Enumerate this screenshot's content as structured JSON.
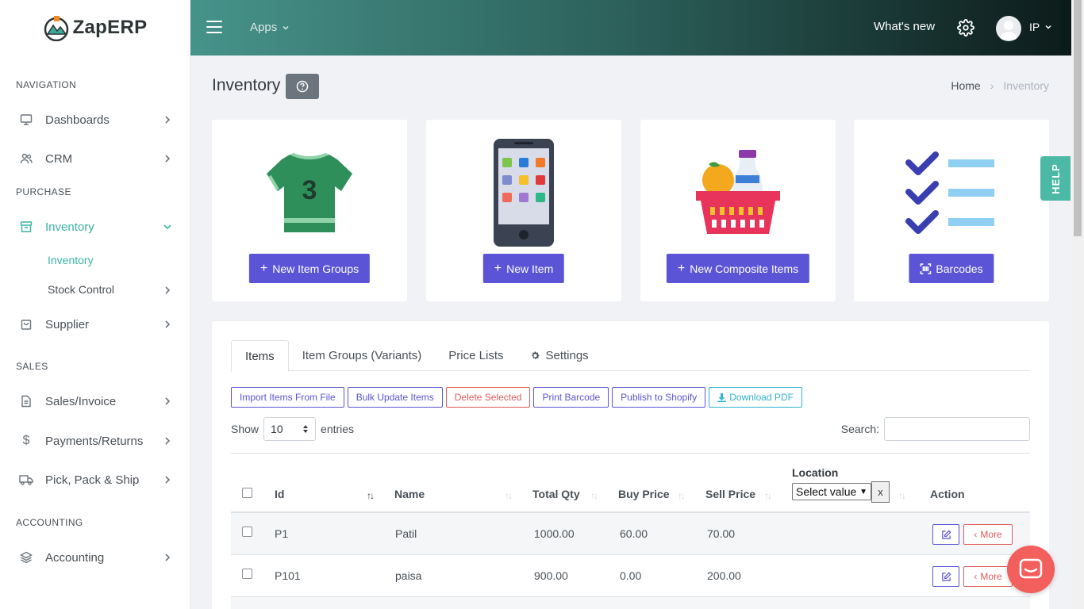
{
  "brand": {
    "name": "ZapERP"
  },
  "topbar": {
    "apps_label": "Apps",
    "whats_new": "What's new",
    "user_initials": "IP"
  },
  "sidebar": {
    "sections": {
      "navigation": "NAVIGATION",
      "purchase": "PURCHASE",
      "sales": "SALES",
      "accounting": "ACCOUNTING"
    },
    "items": {
      "dashboards": "Dashboards",
      "crm": "CRM",
      "inventory": "Inventory",
      "inventory_sub": "Inventory",
      "stock_control": "Stock Control",
      "supplier": "Supplier",
      "sales_invoice": "Sales/Invoice",
      "payments_returns": "Payments/Returns",
      "pick_pack_ship": "Pick, Pack & Ship",
      "accounting": "Accounting"
    }
  },
  "page": {
    "title": "Inventory"
  },
  "breadcrumb": {
    "home": "Home",
    "current": "Inventory"
  },
  "cards": {
    "item_groups": "New Item Groups",
    "item": "New Item",
    "composite": "New Composite Items",
    "barcodes": "Barcodes"
  },
  "help_tab": "HELP",
  "tabs": {
    "items": "Items",
    "item_groups": "Item Groups (Variants)",
    "price_lists": "Price Lists",
    "settings": "Settings"
  },
  "actions": {
    "import": "Import Items From File",
    "bulk_update": "Bulk Update Items",
    "delete_selected": "Delete Selected",
    "print_barcode": "Print Barcode",
    "publish_shopify": "Publish to Shopify",
    "download_pdf": "Download PDF"
  },
  "table_controls": {
    "show": "Show",
    "entries_value": "10",
    "entries": "entries",
    "search": "Search:"
  },
  "table": {
    "headers": {
      "id": "Id",
      "name": "Name",
      "total_qty": "Total Qty",
      "buy_price": "Buy Price",
      "sell_price": "Sell Price",
      "location": "Location",
      "action": "Action"
    },
    "location_select": "Select value",
    "location_clear": "x",
    "more_label": "More",
    "rows": [
      {
        "id": "P1",
        "name": "Patil",
        "total_qty": "1000.00",
        "buy_price": "60.00",
        "sell_price": "70.00"
      },
      {
        "id": "P101",
        "name": "paisa",
        "total_qty": "900.00",
        "buy_price": "0.00",
        "sell_price": "200.00"
      }
    ]
  },
  "colors": {
    "primary": "#5c54d6",
    "accent": "#3ab4a3",
    "danger": "#e05a5a",
    "info": "#30b3d0",
    "chat": "#f25f5c"
  }
}
